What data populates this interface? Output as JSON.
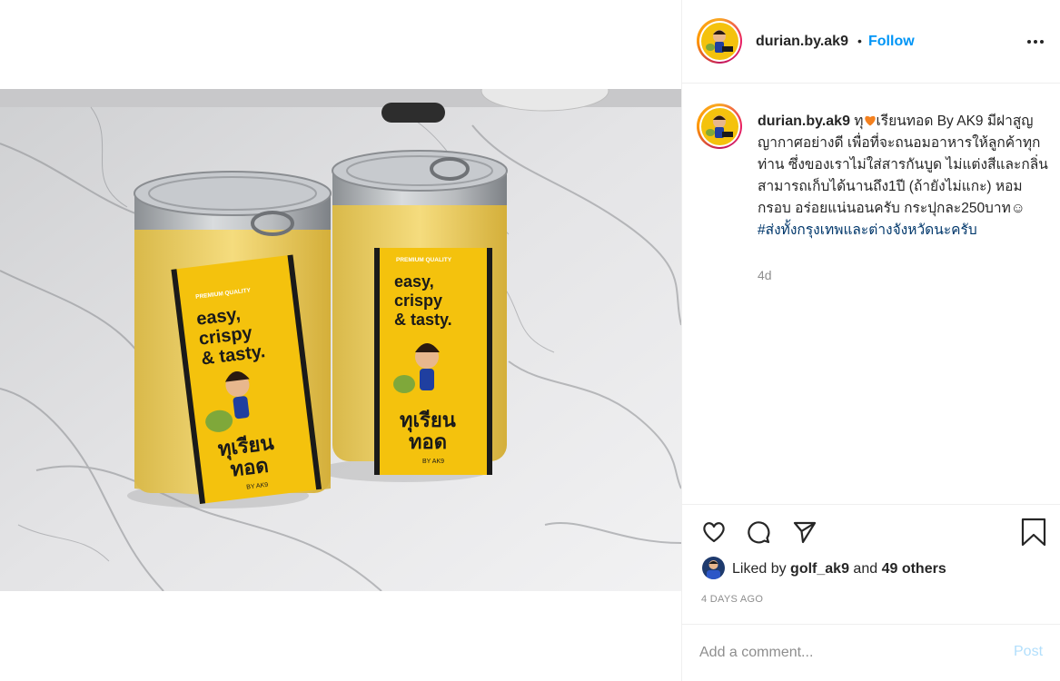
{
  "post": {
    "username": "durian.by.ak9",
    "follow_label": "Follow",
    "separator": "•",
    "caption_parts": {
      "prefix": "ทุ",
      "body": "เรียนทอด By AK9 มีฝาสูญญากาศอย่างดี เพื่อที่จะถนอมอาหารให้ลูกค้าทุกท่าน ซึ่งของเราไม่ใส่สารกันบูด ไม่แต่งสีและกลิ่น สามารถเก็บได้นานถึง1ปี (ถ้ายังไม่แกะ) หอม กรอบ อร่อยแน่นอนครับ กระปุกละ250บาท☺ ",
      "hashtag": "#ส่งทั้งกรุงเทพและต่างจังหวัดนะครับ"
    },
    "relative_time": "4d",
    "likes": {
      "prefix": "Liked by",
      "user": "golf_ak9",
      "conjunction": "and",
      "others": "49 others"
    },
    "date": "4 DAYS AGO",
    "comment_placeholder": "Add a comment...",
    "post_label": "Post"
  },
  "photo": {
    "label_premium": "PREMIUM QUALITY",
    "label_slogan_1": "easy,",
    "label_slogan_2": "crispy",
    "label_slogan_3": "& tasty.",
    "label_thai_1": "ทุเรียน",
    "label_thai_2": "ทอด",
    "label_by": "BY AK9"
  },
  "icons": {
    "heart": "heart-icon",
    "comment": "comment-icon",
    "share": "paper-plane-icon",
    "save": "bookmark-icon",
    "more": "more-dots-icon"
  },
  "colors": {
    "accent": "#0095f6",
    "hashtag": "#00376b",
    "muted": "#8e8e8e",
    "post_disabled": "#b2dffc",
    "label_yellow": "#f4c20d"
  }
}
